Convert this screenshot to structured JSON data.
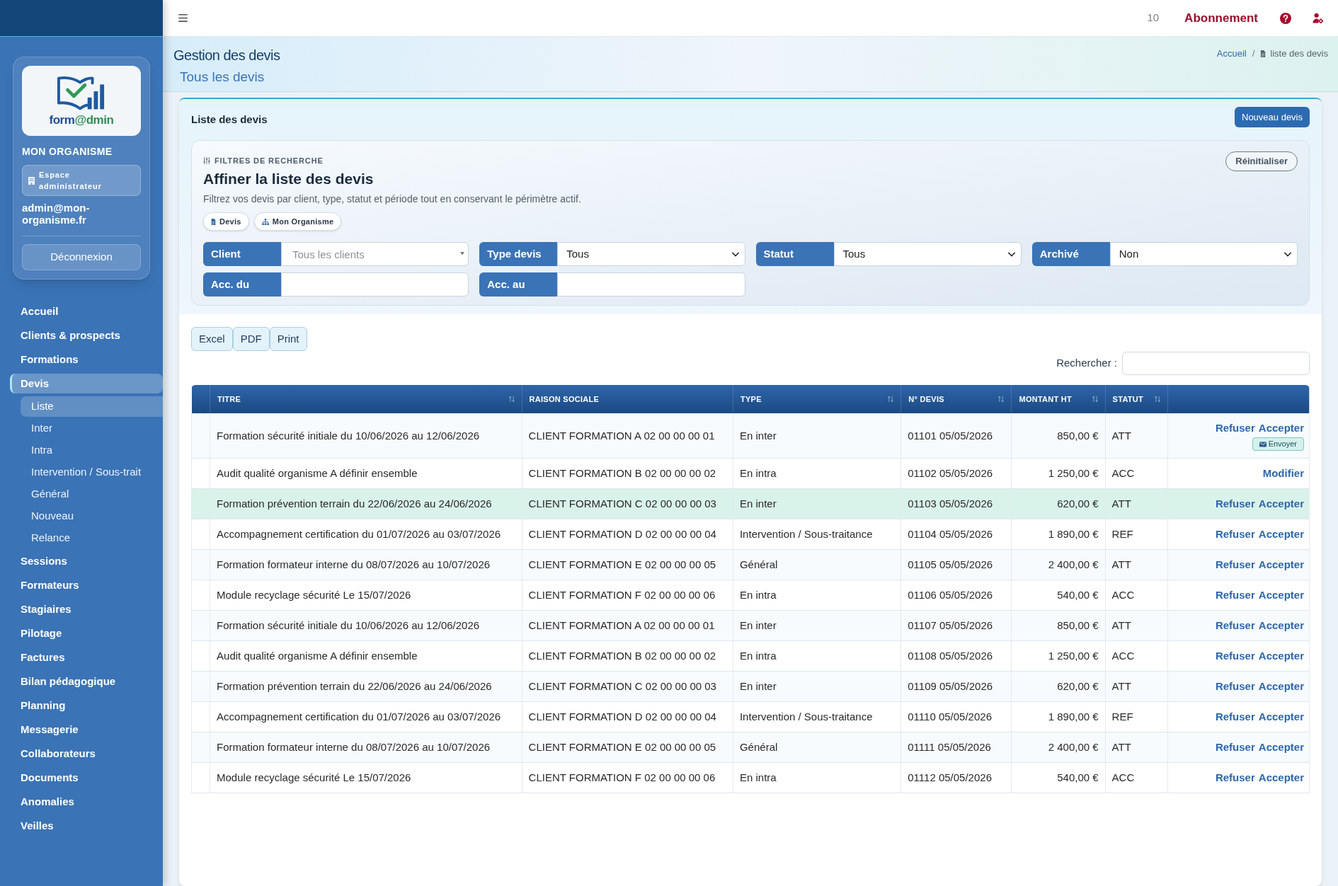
{
  "sidebar": {
    "logo": {
      "text_parts": [
        "form",
        "@dmin"
      ]
    },
    "organization": "MON ORGANISME",
    "role": "Espace administrateur",
    "email": "admin@mon-organisme.fr",
    "logout_button": "Déconnexion",
    "menu": [
      {
        "label": "Accueil",
        "selected": false
      },
      {
        "label": "Clients & prospects",
        "selected": false
      },
      {
        "label": "Formations",
        "selected": false
      },
      {
        "label": "Devis",
        "selected": true,
        "children": [
          {
            "label": "Liste",
            "selected": true
          },
          {
            "label": "Inter",
            "selected": false
          },
          {
            "label": "Intra",
            "selected": false
          },
          {
            "label": "Intervention / Sous-trait",
            "selected": false
          },
          {
            "label": "Général",
            "selected": false
          },
          {
            "label": "Nouveau",
            "selected": false
          },
          {
            "label": "Relance",
            "selected": false
          }
        ]
      },
      {
        "label": "Sessions",
        "selected": false
      },
      {
        "label": "Formateurs",
        "selected": false
      },
      {
        "label": "Stagiaires",
        "selected": false
      },
      {
        "label": "Pilotage",
        "selected": false
      },
      {
        "label": "Factures",
        "selected": false
      },
      {
        "label": "Bilan pédagogique",
        "selected": false
      },
      {
        "label": "Planning",
        "selected": false
      },
      {
        "label": "Messagerie",
        "selected": false
      },
      {
        "label": "Collaborateurs",
        "selected": false
      },
      {
        "label": "Documents",
        "selected": false
      },
      {
        "label": "Anomalies",
        "selected": false
      },
      {
        "label": "Veilles",
        "selected": false
      }
    ]
  },
  "topbar": {
    "count": "10",
    "subscription_link": "Abonnement"
  },
  "page_header": {
    "title": "Gestion des devis",
    "subtitle": "Tous les devis",
    "breadcrumb": {
      "separator": "/",
      "items": [
        {
          "label": "Accueil",
          "kind": "link"
        },
        {
          "label": "liste des devis",
          "kind": "current"
        }
      ]
    }
  },
  "card": {
    "title": "Liste des devis",
    "new_button": "Nouveau devis",
    "filters": {
      "eyebrow": "FILTRES DE RECHERCHE",
      "heading": "Affiner la liste des devis",
      "description": "Filtrez vos devis par client, type, statut et période tout en conservant le périmètre actif.",
      "reset_button": "Réinitialiser",
      "chips": [
        {
          "label": "Devis",
          "kind": "document"
        },
        {
          "label": "Mon Organisme",
          "kind": "organization"
        }
      ],
      "fields": [
        {
          "label": "Client",
          "kind": "combo",
          "placeholder": "Tous les clients"
        },
        {
          "label": "Type devis",
          "kind": "select",
          "value": "Tous"
        },
        {
          "label": "Statut",
          "kind": "select",
          "value": "Tous"
        },
        {
          "label": "Archivé",
          "kind": "select",
          "value": "Non"
        },
        {
          "label": "Acc. du",
          "kind": "date"
        },
        {
          "label": "Acc. au",
          "kind": "date"
        }
      ]
    },
    "export_buttons": [
      "Excel",
      "PDF",
      "Print"
    ],
    "search": {
      "label": "Rechercher :"
    },
    "table": {
      "columns": [
        {
          "label": "TITRE",
          "kind": "text",
          "sortable": true
        },
        {
          "label": "RAISON SOCIALE",
          "kind": "text",
          "sortable": false
        },
        {
          "label": "TYPE",
          "kind": "text",
          "sortable": true
        },
        {
          "label": "N° DEVIS",
          "kind": "text",
          "sortable": true
        },
        {
          "label": "MONTANT HT",
          "kind": "amount",
          "sortable": true
        },
        {
          "label": "STATUT",
          "kind": "text",
          "sortable": true
        }
      ],
      "rows": [
        {
          "cells": [
            "Formation sécurité initiale du 10/06/2026 au 12/06/2026",
            "CLIENT FORMATION A 02 00 00 00 01",
            "En inter",
            "01101 05/05/2026",
            "850,00 €",
            "ATT"
          ],
          "highlighted": false,
          "actions": [
            "Refuser",
            "Accepter"
          ],
          "send_button": "Envoyer"
        },
        {
          "cells": [
            "Audit qualité organisme A définir ensemble",
            "CLIENT FORMATION B 02 00 00 00 02",
            "En intra",
            "01102 05/05/2026",
            "1 250,00 €",
            "ACC"
          ],
          "highlighted": false,
          "actions": [
            "Modifier"
          ]
        },
        {
          "cells": [
            "Formation prévention terrain du 22/06/2026 au 24/06/2026",
            "CLIENT FORMATION C 02 00 00 00 03",
            "En inter",
            "01103 05/05/2026",
            "620,00 €",
            "ATT"
          ],
          "highlighted": true,
          "actions": [
            "Refuser",
            "Accepter"
          ]
        },
        {
          "cells": [
            "Accompagnement certification du 01/07/2026 au 03/07/2026",
            "CLIENT FORMATION D 02 00 00 00 04",
            "Intervention / Sous-traitance",
            "01104 05/05/2026",
            "1 890,00 €",
            "REF"
          ],
          "highlighted": false,
          "actions": [
            "Refuser",
            "Accepter"
          ]
        },
        {
          "cells": [
            "Formation formateur interne du 08/07/2026 au 10/07/2026",
            "CLIENT FORMATION E 02 00 00 00 05",
            "Général",
            "01105 05/05/2026",
            "2 400,00 €",
            "ATT"
          ],
          "highlighted": false,
          "actions": [
            "Refuser",
            "Accepter"
          ]
        },
        {
          "cells": [
            "Module recyclage sécurité Le 15/07/2026",
            "CLIENT FORMATION F 02 00 00 00 06",
            "En intra",
            "01106 05/05/2026",
            "540,00 €",
            "ACC"
          ],
          "highlighted": false,
          "actions": [
            "Refuser",
            "Accepter"
          ]
        },
        {
          "cells": [
            "Formation sécurité initiale du 10/06/2026 au 12/06/2026",
            "CLIENT FORMATION A 02 00 00 00 01",
            "En inter",
            "01107 05/05/2026",
            "850,00 €",
            "ATT"
          ],
          "highlighted": false,
          "actions": [
            "Refuser",
            "Accepter"
          ]
        },
        {
          "cells": [
            "Audit qualité organisme A définir ensemble",
            "CLIENT FORMATION B 02 00 00 00 02",
            "En intra",
            "01108 05/05/2026",
            "1 250,00 €",
            "ACC"
          ],
          "highlighted": false,
          "actions": [
            "Refuser",
            "Accepter"
          ]
        },
        {
          "cells": [
            "Formation prévention terrain du 22/06/2026 au 24/06/2026",
            "CLIENT FORMATION C 02 00 00 00 03",
            "En inter",
            "01109 05/05/2026",
            "620,00 €",
            "ATT"
          ],
          "highlighted": false,
          "actions": [
            "Refuser",
            "Accepter"
          ]
        },
        {
          "cells": [
            "Accompagnement certification du 01/07/2026 au 03/07/2026",
            "CLIENT FORMATION D 02 00 00 00 04",
            "Intervention / Sous-traitance",
            "01110 05/05/2026",
            "1 890,00 €",
            "REF"
          ],
          "highlighted": false,
          "actions": [
            "Refuser",
            "Accepter"
          ]
        },
        {
          "cells": [
            "Formation formateur interne du 08/07/2026 au 10/07/2026",
            "CLIENT FORMATION E 02 00 00 00 05",
            "Général",
            "01111 05/05/2026",
            "2 400,00 €",
            "ATT"
          ],
          "highlighted": false,
          "actions": [
            "Refuser",
            "Accepter"
          ]
        },
        {
          "cells": [
            "Module recyclage sécurité Le 15/07/2026",
            "CLIENT FORMATION F 02 00 00 00 06",
            "En intra",
            "01112 05/05/2026",
            "540,00 €",
            "ACC"
          ],
          "highlighted": false,
          "actions": [
            "Refuser",
            "Accepter"
          ]
        }
      ]
    }
  }
}
